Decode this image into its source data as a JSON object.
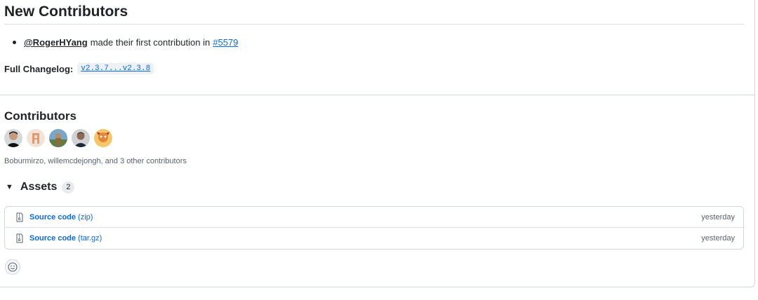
{
  "new_contributors": {
    "heading": "New Contributors",
    "mention": "@RogerHYang",
    "text": "made their first contribution in",
    "pr_link": "#5579"
  },
  "changelog": {
    "label": "Full Changelog:",
    "range": "v2.3.7...v2.3.8"
  },
  "contributors": {
    "heading": "Contributors",
    "avatars": [
      "avatar-1",
      "avatar-2",
      "avatar-3",
      "avatar-4",
      "avatar-5"
    ],
    "summary": "Boburmirzo, willemcdejongh, and 3 other contributors"
  },
  "assets": {
    "heading": "Assets",
    "count": "2",
    "items": [
      {
        "name": "Source code",
        "ext": "(zip)",
        "date": "yesterday",
        "icon": "file-zip-icon"
      },
      {
        "name": "Source code",
        "ext": "(tar.gz)",
        "date": "yesterday",
        "icon": "file-zip-icon"
      }
    ]
  },
  "reactions": {
    "icon": "smiley-icon"
  },
  "colors": {
    "link": "#0969da",
    "muted": "#59636e",
    "border": "#d0d7de"
  }
}
